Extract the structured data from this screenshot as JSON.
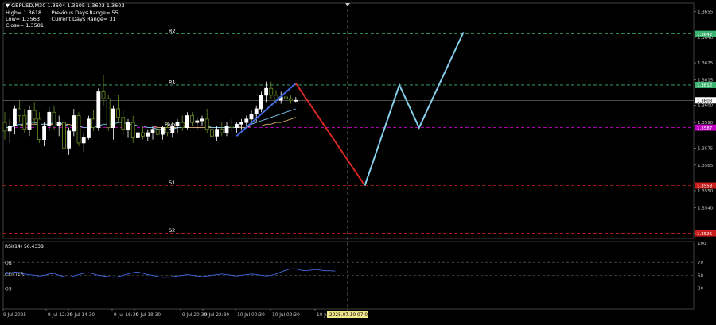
{
  "header": {
    "symbol": "GBPUSD,M30",
    "ohlc": "1.3604 1.3605 1.3603 1.3603",
    "high": "High= 1.3618",
    "prev_range": "Previous Days Range= 55",
    "low": "Low= 1.3563",
    "curr_range": "Current Days Range= 31",
    "close": "Close= 1.3581"
  },
  "levels": {
    "r2": {
      "label": "R2",
      "value": 1.3642,
      "tag": "1.3642",
      "color": "#3cb371"
    },
    "r1": {
      "label": "R1",
      "value": 1.3612,
      "tag": "1.3612",
      "color": "#3cb371"
    },
    "pivot": {
      "label": "Pivot",
      "value": 1.3587,
      "tag": "1.3587",
      "color": "#c000c0"
    },
    "s1": {
      "label": "S1",
      "value": 1.3553,
      "tag": "1.3553",
      "color": "#c81e1e"
    },
    "s2": {
      "label": "S2",
      "value": 1.3525,
      "tag": "1.3525",
      "color": "#c81e1e"
    },
    "current": {
      "value": 1.3603,
      "tag": "1.3603"
    }
  },
  "price_axis": {
    "ticks": [
      {
        "v": 1.3655,
        "t": "1.3655"
      },
      {
        "v": 1.364,
        "t": "1.3640"
      },
      {
        "v": 1.3625,
        "t": "1.3625"
      },
      {
        "v": 1.3615,
        "t": "1.3615"
      },
      {
        "v": 1.36,
        "t": "1.3600"
      },
      {
        "v": 1.359,
        "t": "1.3590"
      },
      {
        "v": 1.3575,
        "t": "1.3575"
      },
      {
        "v": 1.3565,
        "t": "1.3565"
      },
      {
        "v": 1.355,
        "t": "1.3550"
      },
      {
        "v": 1.354,
        "t": "1.3540"
      },
      {
        "v": 1.3525,
        "t": "1.3525"
      }
    ],
    "ylim": [
      1.3522,
      1.366
    ]
  },
  "time_axis": {
    "labels": [
      "9 Jul 2025",
      "9 Jul 12:30",
      "9 Jul 14:30",
      "9 Jul 16:30",
      "9 Jul 18:30",
      "9 Jul 20:30",
      "9 Jul 22:30",
      "10 Jul 00:30",
      "10 Jul 02:30",
      "10 Jul 04:"
    ],
    "highlight": "2025.07.10 07:00"
  },
  "rsi": {
    "title": "RSI(14) 56.4338",
    "ob": "OB",
    "center": "CENTER",
    "os": "OS",
    "ticks": [
      {
        "v": 100,
        "t": "100"
      },
      {
        "v": 70,
        "t": "70"
      },
      {
        "v": 50,
        "t": "50"
      },
      {
        "v": 30,
        "t": "30"
      }
    ],
    "values": [
      52,
      53,
      55,
      54,
      52,
      51,
      50,
      49,
      50,
      52,
      53,
      50,
      48,
      47,
      49,
      51,
      53,
      54,
      52,
      50,
      49,
      48,
      47,
      48,
      50,
      52,
      54,
      55,
      53,
      51,
      50,
      48,
      47,
      47,
      48,
      49,
      50,
      51,
      50,
      49,
      48,
      49,
      50,
      51,
      52,
      51,
      50,
      49,
      50,
      51,
      52,
      51,
      50,
      49,
      50,
      52,
      55,
      58,
      60,
      60,
      58,
      57,
      58,
      59,
      58,
      57,
      57,
      56.4
    ],
    "color": "#4169e1"
  },
  "chart_data": {
    "type": "candlestick",
    "title": "GBPUSD,M30",
    "candles": [
      [
        1.359,
        1.3596,
        1.358,
        1.3585
      ],
      [
        1.3585,
        1.3592,
        1.3578,
        1.3588
      ],
      [
        1.3588,
        1.36,
        1.3583,
        1.3598
      ],
      [
        1.3598,
        1.3603,
        1.359,
        1.3594
      ],
      [
        1.3594,
        1.3598,
        1.3584,
        1.3586
      ],
      [
        1.3586,
        1.36,
        1.3582,
        1.3597
      ],
      [
        1.3597,
        1.3602,
        1.3589,
        1.3592
      ],
      [
        1.3592,
        1.3596,
        1.3578,
        1.358
      ],
      [
        1.358,
        1.359,
        1.3576,
        1.3588
      ],
      [
        1.3588,
        1.3599,
        1.3585,
        1.3596
      ],
      [
        1.3596,
        1.36,
        1.3586,
        1.3588
      ],
      [
        1.3588,
        1.3594,
        1.3582,
        1.359
      ],
      [
        1.359,
        1.3593,
        1.3572,
        1.3575
      ],
      [
        1.3575,
        1.3587,
        1.3571,
        1.3585
      ],
      [
        1.3585,
        1.3598,
        1.3582,
        1.3594
      ],
      [
        1.3594,
        1.3596,
        1.3576,
        1.3578
      ],
      [
        1.3578,
        1.3584,
        1.3573,
        1.3581
      ],
      [
        1.3581,
        1.3594,
        1.358,
        1.3592
      ],
      [
        1.3592,
        1.3597,
        1.3585,
        1.3587
      ],
      [
        1.3587,
        1.361,
        1.3585,
        1.3608
      ],
      [
        1.3608,
        1.3618,
        1.36,
        1.3604
      ],
      [
        1.3604,
        1.3606,
        1.3585,
        1.3587
      ],
      [
        1.3587,
        1.36,
        1.358,
        1.3598
      ],
      [
        1.3598,
        1.3606,
        1.359,
        1.3593
      ],
      [
        1.3593,
        1.3597,
        1.3583,
        1.3586
      ],
      [
        1.3586,
        1.3592,
        1.3581,
        1.359
      ],
      [
        1.359,
        1.3594,
        1.3578,
        1.3581
      ],
      [
        1.3581,
        1.3587,
        1.3578,
        1.3584
      ],
      [
        1.3584,
        1.3588,
        1.358,
        1.3582
      ],
      [
        1.3582,
        1.3586,
        1.3579,
        1.3584
      ],
      [
        1.3584,
        1.3588,
        1.358,
        1.3586
      ],
      [
        1.3586,
        1.3588,
        1.3582,
        1.3583
      ],
      [
        1.3583,
        1.3588,
        1.358,
        1.3587
      ],
      [
        1.3587,
        1.359,
        1.3582,
        1.3584
      ],
      [
        1.3584,
        1.359,
        1.3581,
        1.3588
      ],
      [
        1.3588,
        1.3592,
        1.3584,
        1.359
      ],
      [
        1.359,
        1.3594,
        1.3585,
        1.3587
      ],
      [
        1.3587,
        1.3596,
        1.3586,
        1.3594
      ],
      [
        1.3594,
        1.3596,
        1.3588,
        1.359
      ],
      [
        1.359,
        1.3593,
        1.3586,
        1.3591
      ],
      [
        1.3591,
        1.3594,
        1.3588,
        1.3592
      ],
      [
        1.3592,
        1.3598,
        1.3584,
        1.3586
      ],
      [
        1.3586,
        1.359,
        1.358,
        1.3582
      ],
      [
        1.3582,
        1.3588,
        1.3579,
        1.3586
      ],
      [
        1.3586,
        1.359,
        1.3582,
        1.3584
      ],
      [
        1.3584,
        1.359,
        1.3582,
        1.3588
      ],
      [
        1.3588,
        1.3592,
        1.3585,
        1.3587
      ],
      [
        1.3587,
        1.359,
        1.3584,
        1.3589
      ],
      [
        1.3589,
        1.3592,
        1.3586,
        1.359
      ],
      [
        1.359,
        1.3594,
        1.3587,
        1.3592
      ],
      [
        1.3592,
        1.3597,
        1.3589,
        1.3595
      ],
      [
        1.3595,
        1.36,
        1.359,
        1.3598
      ],
      [
        1.3598,
        1.3608,
        1.3596,
        1.3606
      ],
      [
        1.3606,
        1.3614,
        1.3602,
        1.361
      ],
      [
        1.361,
        1.3614,
        1.3604,
        1.3606
      ],
      [
        1.3606,
        1.3609,
        1.3601,
        1.3603
      ],
      [
        1.3603,
        1.3608,
        1.3601,
        1.3605
      ],
      [
        1.3605,
        1.3609,
        1.3602,
        1.3604
      ],
      [
        1.3604,
        1.3606,
        1.3601,
        1.3603
      ],
      [
        1.3603,
        1.3605,
        1.3602,
        1.3603
      ]
    ],
    "ma_fast_color": "#7ec8f0",
    "ma_slow_color": "#d8b36a",
    "ma_fast": [
      1.3587,
      1.3587,
      1.3588,
      1.3589,
      1.3589,
      1.359,
      1.359,
      1.3589,
      1.3589,
      1.3589,
      1.359,
      1.359,
      1.3589,
      1.3588,
      1.3588,
      1.3588,
      1.3587,
      1.3587,
      1.3587,
      1.3588,
      1.3589,
      1.3589,
      1.3589,
      1.359,
      1.359,
      1.3589,
      1.3589,
      1.3588,
      1.3588,
      1.3587,
      1.3587,
      1.3586,
      1.3586,
      1.3586,
      1.3586,
      1.3587,
      1.3587,
      1.3588,
      1.3588,
      1.3588,
      1.3588,
      1.3588,
      1.3587,
      1.3587,
      1.3587,
      1.3587,
      1.3587,
      1.3587,
      1.3588,
      1.3588,
      1.3589,
      1.359,
      1.3591,
      1.3592,
      1.3593,
      1.3594,
      1.3595,
      1.3596,
      1.3597,
      1.3598
    ],
    "ma_slow": [
      1.3588,
      1.3588,
      1.3588,
      1.3588,
      1.3589,
      1.3589,
      1.3589,
      1.3589,
      1.3589,
      1.3589,
      1.3589,
      1.3589,
      1.3589,
      1.3589,
      1.3588,
      1.3588,
      1.3588,
      1.3588,
      1.3588,
      1.3588,
      1.3588,
      1.3588,
      1.3588,
      1.3588,
      1.3588,
      1.3588,
      1.3588,
      1.3588,
      1.3588,
      1.3588,
      1.3588,
      1.3587,
      1.3587,
      1.3587,
      1.3587,
      1.3587,
      1.3587,
      1.3587,
      1.3587,
      1.3587,
      1.3587,
      1.3587,
      1.3587,
      1.3587,
      1.3587,
      1.3587,
      1.3587,
      1.3587,
      1.3587,
      1.3587,
      1.3588,
      1.3588,
      1.3588,
      1.3589,
      1.3589,
      1.359,
      1.359,
      1.3591,
      1.3592,
      1.3593
    ],
    "up_color": "#ffffff",
    "down_color": "#6b8e23",
    "projection": [
      {
        "color": "#4169e1",
        "points": [
          [
            47,
            1.3582
          ],
          [
            59,
            1.3613
          ]
        ]
      },
      {
        "color": "#dc2626",
        "points": [
          [
            59,
            1.3613
          ],
          [
            73,
            1.3553
          ]
        ]
      },
      {
        "color": "#87ceeb",
        "points": [
          [
            73,
            1.3553
          ],
          [
            80,
            1.3612
          ],
          [
            84,
            1.3587
          ],
          [
            93,
            1.3643
          ]
        ]
      }
    ]
  }
}
